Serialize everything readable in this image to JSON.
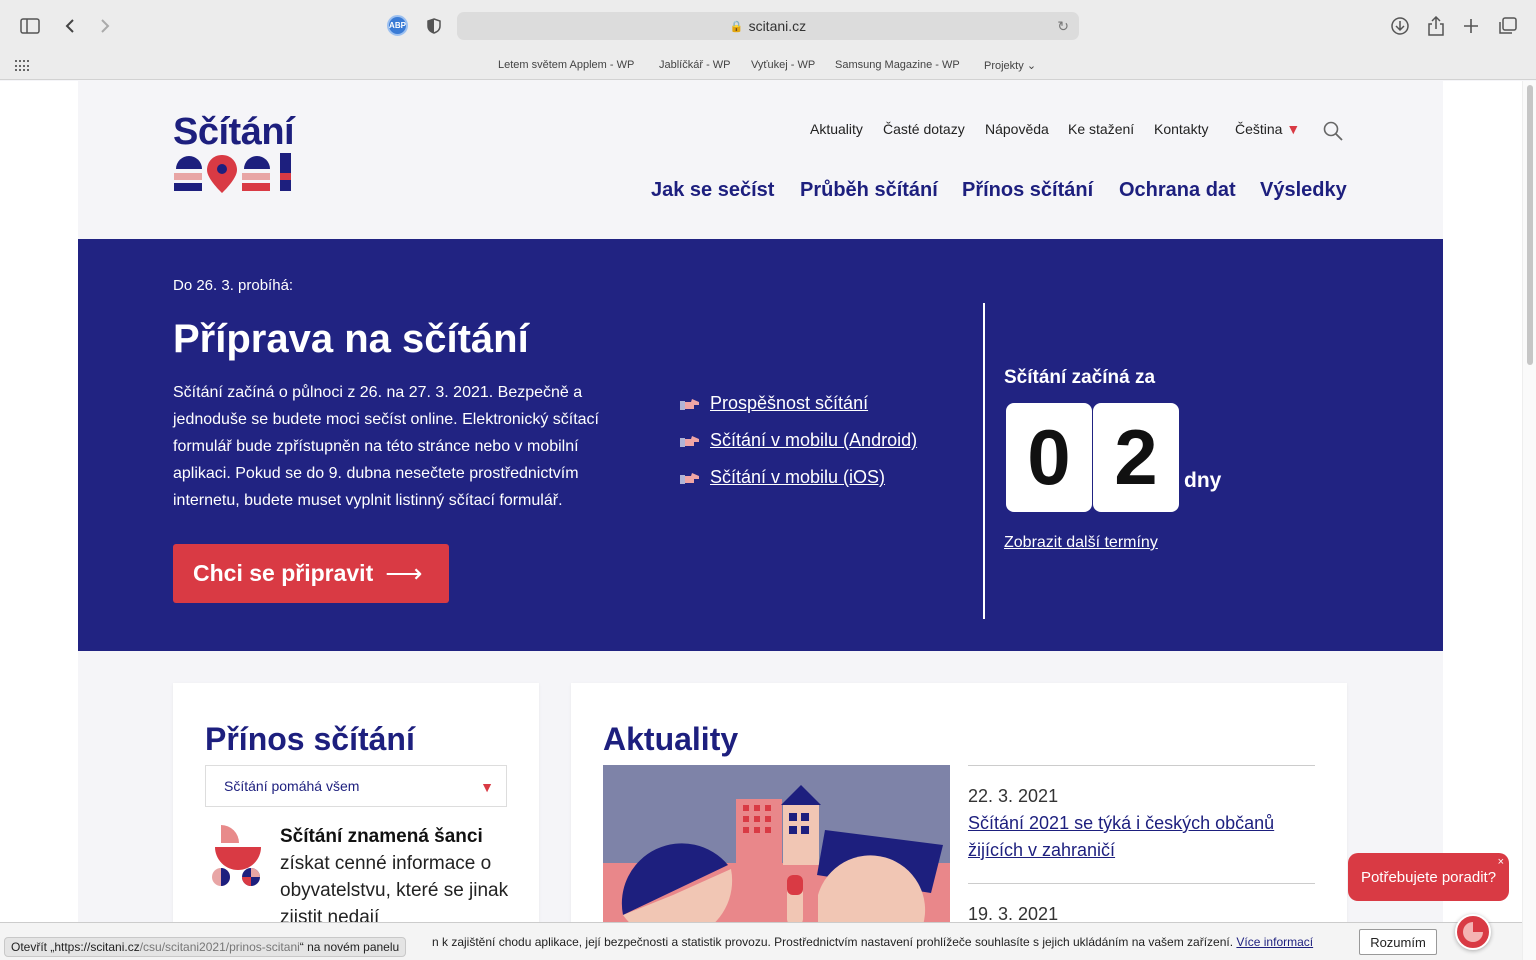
{
  "browser": {
    "url": "scitani.cz",
    "abp_label": "ABP",
    "bookmarks": [
      "Letem světem Applem - WP",
      "Jablíčkář - WP",
      "Vyťukej - WP",
      "Samsung Magazine - WP",
      "Projekty"
    ],
    "status_prefix": "Otevřít „https://scitani.cz",
    "status_path": "/csu/scitani2021/prinos-scitani",
    "status_suffix": "“ na novém panelu"
  },
  "header": {
    "logo_title": "Sčítání",
    "logo_year": "2021",
    "top_nav": [
      "Aktuality",
      "Časté dotazy",
      "Nápověda",
      "Ke stažení",
      "Kontakty"
    ],
    "language": "Čeština",
    "main_nav": [
      "Jak se sečíst",
      "Průběh sčítání",
      "Přínos sčítání",
      "Ochrana dat",
      "Výsledky"
    ]
  },
  "hero": {
    "kicker": "Do 26. 3. probíhá:",
    "title": "Příprava na sčítání",
    "text": "Sčítání začíná o půlnoci z 26. na 27. 3. 2021. Bezpečně a jednoduše se budete moci sečíst online. Elektronický sčítací formulář bude zpřístupněn na této stránce nebo v mobilní aplikaci. Pokud se do 9. dubna nesečtete prostřednictvím internetu, budete muset vyplnit listinný sčítací formulář.",
    "cta_label": "Chci se připravit",
    "cta_arrow": "⟶",
    "links": [
      "Prospěšnost sčítání",
      "Sčítání v mobilu (Android)",
      "Sčítání v mobilu (iOS)"
    ],
    "countdown_label": "Sčítání začíná za",
    "digits": [
      "0",
      "2"
    ],
    "unit": "dny",
    "more_dates": "Zobrazit další termíny"
  },
  "benefits": {
    "title": "Přínos sčítání",
    "select_value": "Sčítání pomáhá všem",
    "lead_bold": "Sčítání znamená šanci",
    "lead_rest": " získat cenné informace o obyvatelstvu, které se jinak zjistit nedají"
  },
  "news": {
    "title": "Aktuality",
    "items": [
      {
        "date": "22. 3. 2021",
        "title": "Sčítání 2021 se týká i českých občanů žijících v zahraničí"
      },
      {
        "date": "19. 3. 2021",
        "title": ""
      }
    ]
  },
  "chat": {
    "prompt": "Potřebujete poradit?",
    "close": "×"
  },
  "cookie": {
    "text": "n k zajištění chodu aplikace, její bezpečnosti a statistik provozu. Prostřednictvím nastavení prohlížeče souhlasíte s jejich ukládáním na vašem zařízení.",
    "link": "Více informací",
    "button": "Rozumím"
  },
  "colors": {
    "brand_navy": "#212382",
    "brand_red": "#d93a44"
  }
}
